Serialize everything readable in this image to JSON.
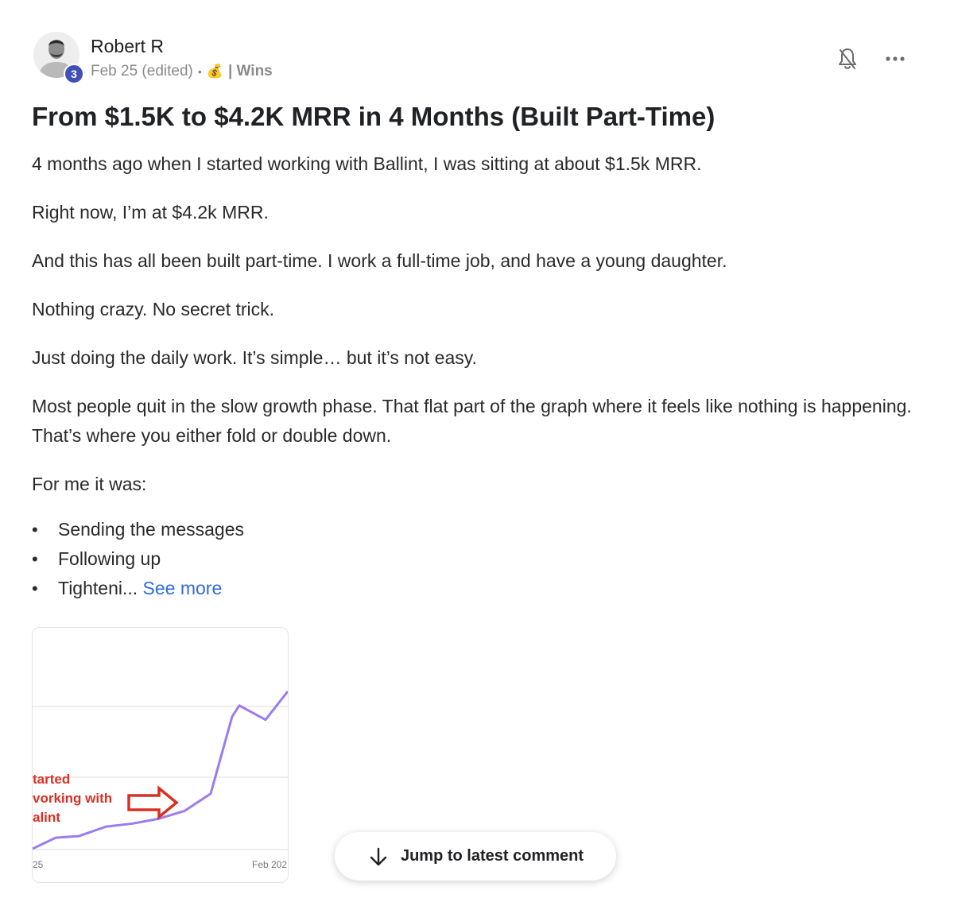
{
  "author": {
    "name": "Robert R",
    "level": "3",
    "date": "Feb 25 (edited)",
    "separator": "•",
    "category_icon": "money-bag-icon",
    "category": "| Wins"
  },
  "post": {
    "title": "From $1.5K to $4.2K MRR in 4 Months (Built Part-Time)",
    "paragraphs": [
      "4 months ago when I started working with Ballint, I was sitting at about $1.5k MRR.",
      "Right now, I’m at $4.2k MRR.",
      "And this has all been built part-time. I work a full-time job, and have a young daughter.",
      "Nothing crazy. No secret trick.",
      "Just doing the daily work. It’s simple… but it’s not easy.",
      "Most people quit in the slow growth phase. That flat part of the graph where it feels like nothing is happening. That’s where you either fold or double down.",
      "For me it was:"
    ],
    "bullets": [
      "Sending the messages",
      "Following up",
      "Tighteni..."
    ],
    "see_more": "See more"
  },
  "attachment": {
    "annotation_lines": [
      "tarted",
      "vorking with",
      "alint"
    ],
    "x_tick_left": "25",
    "x_tick_right": "Feb 202",
    "line_color": "#9b7cf0",
    "annotation_color": "#d93025"
  },
  "chart_data": {
    "type": "line",
    "series": [
      {
        "values": [
          0.0,
          0.07,
          0.08,
          0.14,
          0.16,
          0.19,
          0.24,
          0.35,
          0.84,
          0.91,
          0.82,
          1.0
        ]
      }
    ],
    "xticks": [
      "25",
      "Feb 202"
    ],
    "annotation": "tarted working with alint",
    "grid": true
  },
  "actions": {
    "jump_label": "Jump to latest comment"
  },
  "icons": {
    "bell": "bell-off-icon",
    "more": "more-horizontal-icon",
    "jump": "arrow-down-icon"
  }
}
